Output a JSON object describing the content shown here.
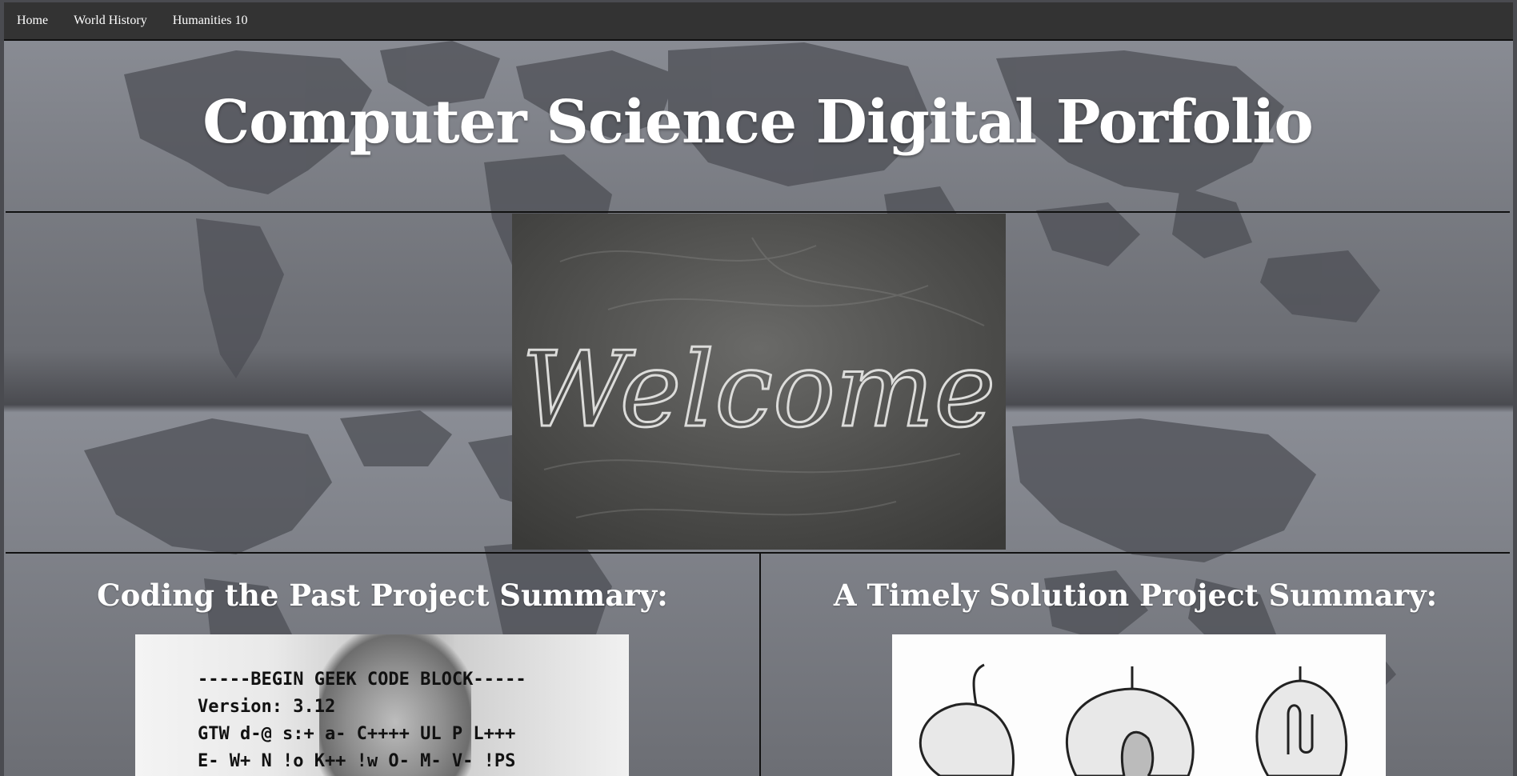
{
  "nav": {
    "items": [
      {
        "label": "Home"
      },
      {
        "label": "World History"
      },
      {
        "label": "Humanities 10"
      }
    ]
  },
  "header": {
    "title": "Computer Science Digital Porfolio"
  },
  "welcome": {
    "image_text": "Welcome"
  },
  "projects": [
    {
      "title": "Coding the Past Project Summary:",
      "image_lines": [
        "-----BEGIN GEEK CODE BLOCK-----",
        "Version: 3.12",
        "GTW d-@ s:+ a- C++++ UL P L+++",
        "E- W+ N !o K++ !w O- M- V- !PS"
      ]
    },
    {
      "title": "A Timely Solution Project Summary:"
    }
  ],
  "colors": {
    "nav_bg": "#333333",
    "title_text": "#ffffff",
    "map_land": "#4d4f55",
    "border": "#111111"
  }
}
